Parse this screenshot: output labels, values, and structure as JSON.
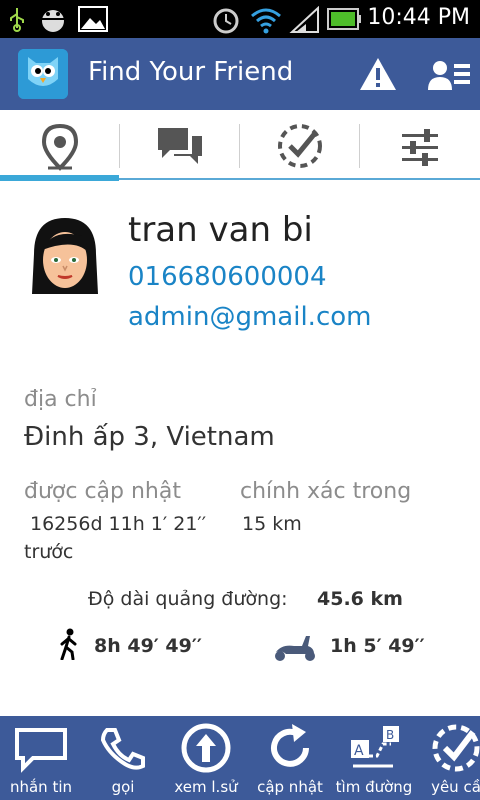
{
  "status_bar": {
    "time": "10:44 PM",
    "icons": [
      "usb-icon",
      "bug-icon",
      "image-icon",
      "alarm-icon",
      "wifi-icon",
      "signal-icon",
      "battery-icon"
    ]
  },
  "app_bar": {
    "title": "Find Your Friend",
    "actions": [
      "warning-icon",
      "contacts-icon"
    ]
  },
  "tabs": [
    {
      "icon": "location-pin-icon",
      "active": true
    },
    {
      "icon": "chat-icon",
      "active": false
    },
    {
      "icon": "check-circle-icon",
      "active": false
    },
    {
      "icon": "settings-sliders-icon",
      "active": false
    }
  ],
  "profile": {
    "name": "tran van bi",
    "phone": "016680600004",
    "email": "admin@gmail.com"
  },
  "address": {
    "label": "địa chỉ",
    "value": "Đinh ấp 3, Vietnam"
  },
  "updated": {
    "label": "được cập nhật",
    "value_line1": "16256d 11h 1′ 21′′",
    "value_line2": "trước"
  },
  "accuracy": {
    "label": "chính xác trong",
    "value": "15 km"
  },
  "distance": {
    "label": "Độ dài quảng đường:",
    "value": "45.6 km"
  },
  "travel_times": {
    "walk": "8h 49′ 49′′",
    "scooter": "1h 5′ 49′′"
  },
  "bottom_bar": [
    {
      "label": "nhắn tin",
      "icon": "message-icon"
    },
    {
      "label": "gọi",
      "icon": "phone-icon"
    },
    {
      "label": "xem l.sử",
      "icon": "history-icon"
    },
    {
      "label": "cập nhật",
      "icon": "refresh-icon"
    },
    {
      "label": "tìm đường",
      "icon": "directions-icon"
    },
    {
      "label": "yêu cầ",
      "icon": "request-icon"
    }
  ],
  "colors": {
    "app_bar": "#3d5a99",
    "accent": "#3ba8d8",
    "link": "#1a84c6"
  }
}
